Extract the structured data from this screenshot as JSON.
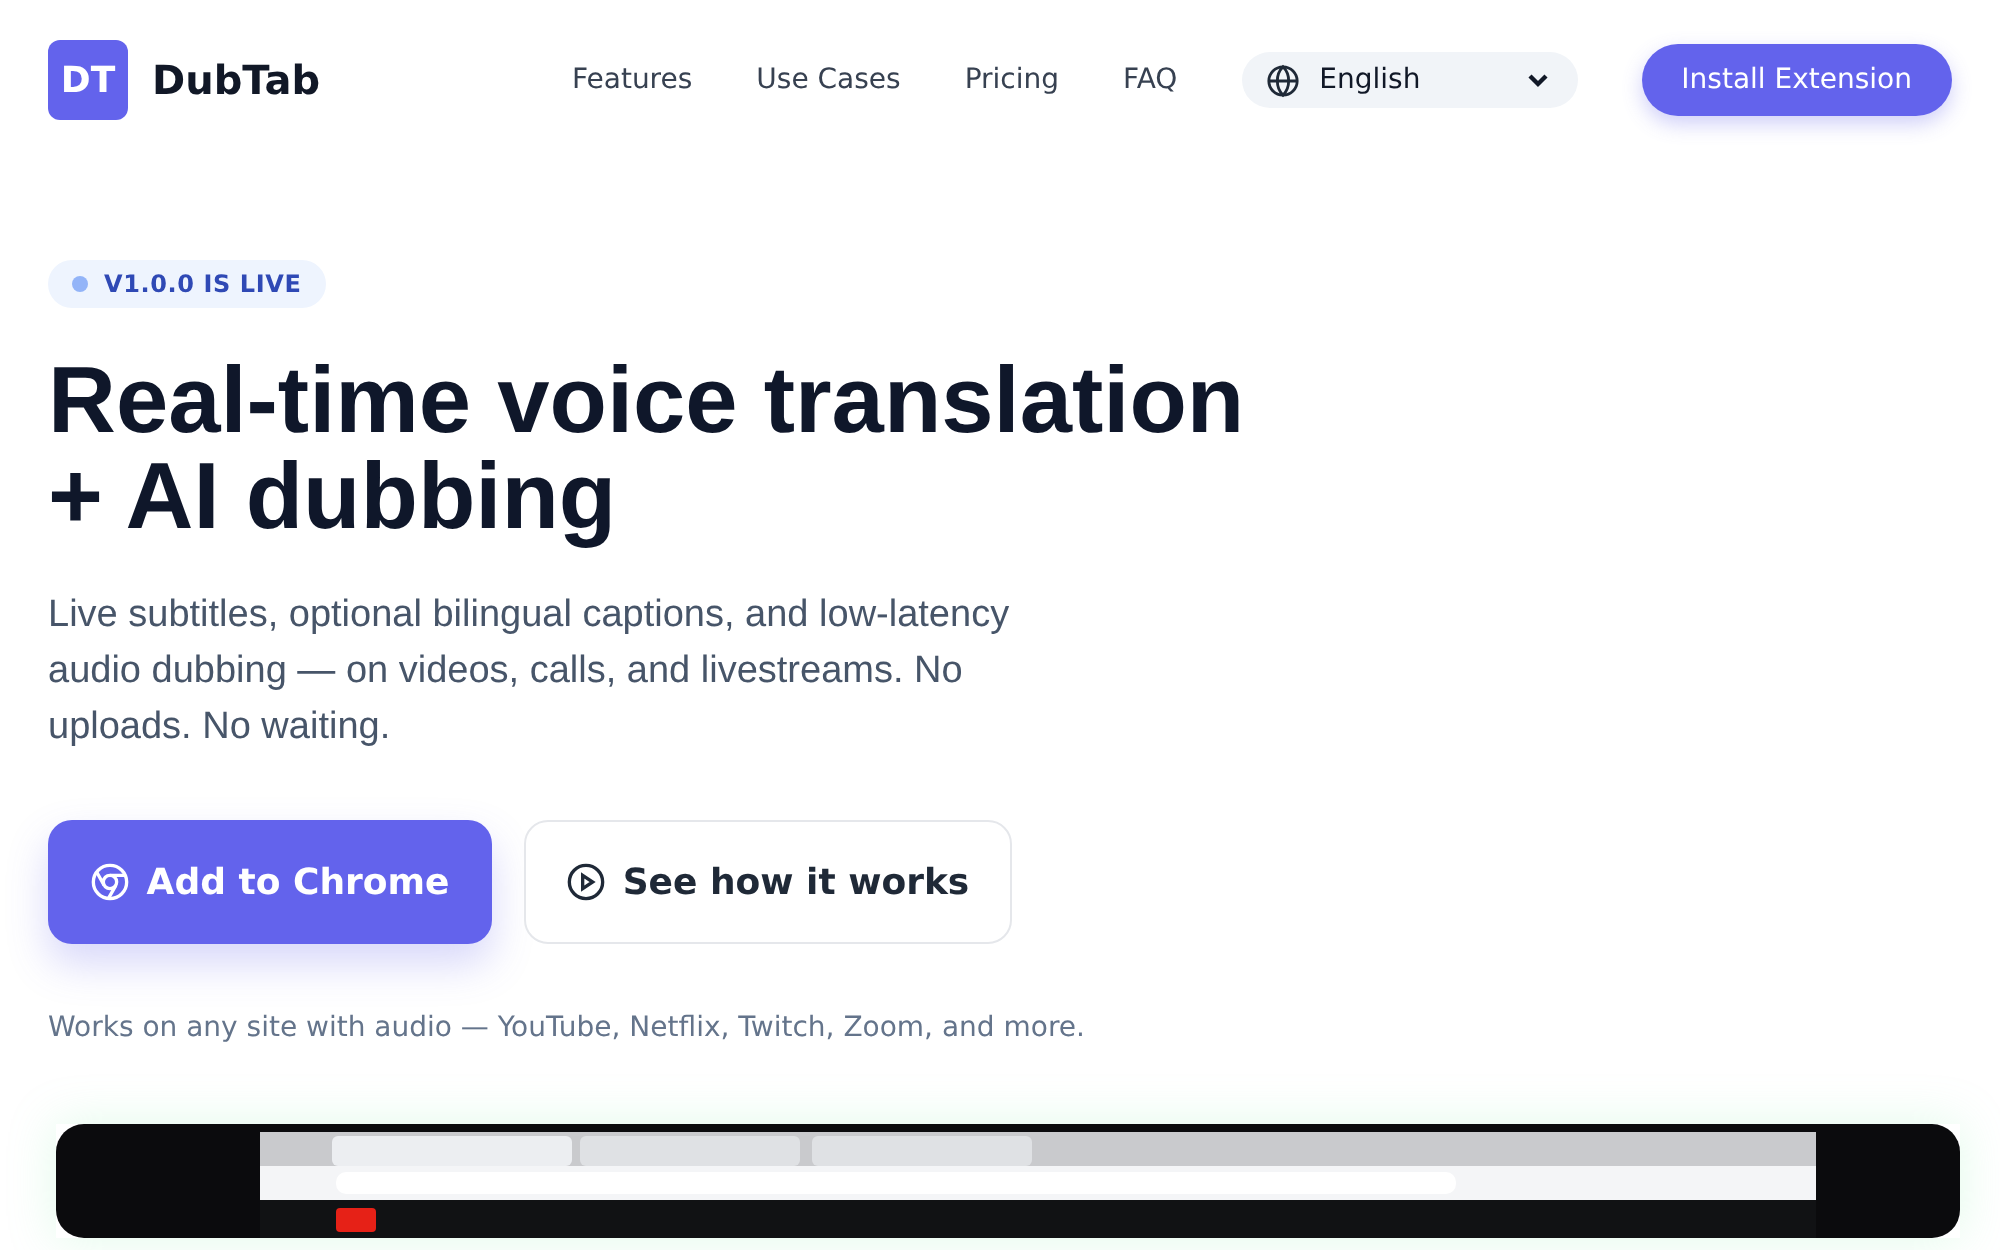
{
  "brand": {
    "logo": "DT",
    "name": "DubTab"
  },
  "nav": [
    "Features",
    "Use Cases",
    "Pricing",
    "FAQ"
  ],
  "language": {
    "value": "English"
  },
  "install_button": "Install Extension",
  "badge": {
    "label": "V1.0.0 IS LIVE",
    "color": "#93b4f8"
  },
  "headline": [
    "Real-time voice translation",
    "+ AI dubbing"
  ],
  "subtitle": "Live subtitles, optional bilingual captions, and low-latency audio dubbing — on videos, calls, and livestreams. No uploads. No waiting.",
  "buttons": [
    {
      "label": "Add to Chrome",
      "kind": "primary"
    },
    {
      "label": "See how it works",
      "kind": "secondary"
    }
  ],
  "note": "Works on any site with audio — YouTube, Netflix, Twitch, Zoom, and more."
}
